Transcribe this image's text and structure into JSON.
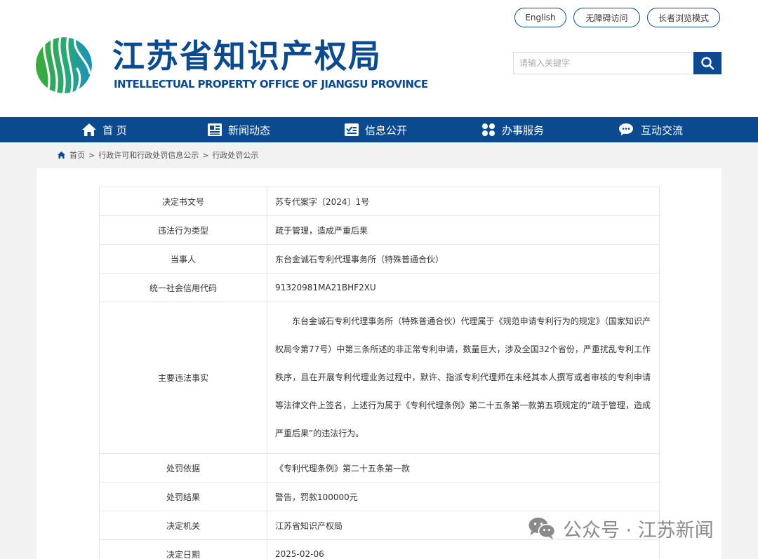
{
  "header": {
    "site_title": "江苏省知识产权局",
    "site_subtitle": "INTELLECTUAL PROPERTY OFFICE OF JIANGSU PROVINCE",
    "top_links": {
      "english": "English",
      "accessibility": "无障碍访问",
      "elder_mode": "长者浏览模式"
    },
    "search": {
      "placeholder": "请输入关键字"
    }
  },
  "nav": {
    "items": [
      {
        "label": "首 页",
        "icon": "home-icon"
      },
      {
        "label": "新闻动态",
        "icon": "news-icon"
      },
      {
        "label": "信息公开",
        "icon": "info-icon"
      },
      {
        "label": "办事服务",
        "icon": "service-icon"
      },
      {
        "label": "互动交流",
        "icon": "chat-icon"
      }
    ]
  },
  "breadcrumb": {
    "items": [
      "首页",
      "行政许可和行政处罚信息公示",
      "行政处罚公示"
    ],
    "separator": ">"
  },
  "table": {
    "rows": [
      {
        "label": "决定书文号",
        "value": "苏专代案字〔2024〕1号"
      },
      {
        "label": "违法行为类型",
        "value": "疏于管理，造成严重后果"
      },
      {
        "label": "当事人",
        "value": "东台金诚石专利代理事务所（特殊普通合伙）"
      },
      {
        "label": "统一社会信用代码",
        "value": "91320981MA21BHF2XU"
      },
      {
        "label": "主要违法事实",
        "value": "东台金诚石专利代理事务所（特殊普通合伙）代理属于《规范申请专利行为的规定》（国家知识产权局令第77号）中第三条所述的非正常专利申请，数量巨大，涉及全国32个省份，严重扰乱专利工作秩序，且在开展专利代理业务过程中，默许、指派专利代理师在未经其本人撰写或者审核的专利申请等法律文件上签名，上述行为属于《专利代理条例》第二十五条第一款第五项规定的“疏于管理，造成严重后果”的违法行为。"
      },
      {
        "label": "处罚依据",
        "value": "《专利代理条例》第二十五条第一款"
      },
      {
        "label": "处罚结果",
        "value": "警告，罚款100000元"
      },
      {
        "label": "决定机关",
        "value": "江苏省知识产权局"
      },
      {
        "label": "决定日期",
        "value": "2025-02-06"
      }
    ]
  },
  "watermark": {
    "text": "公众号 · 江苏新闻",
    "icon": "wechat-icon"
  },
  "colors": {
    "brand_blue": "#0b4a8f",
    "logo_green": "#3aaa35",
    "logo_teal": "#1aa5a0",
    "page_bg": "#f2f2f2"
  }
}
